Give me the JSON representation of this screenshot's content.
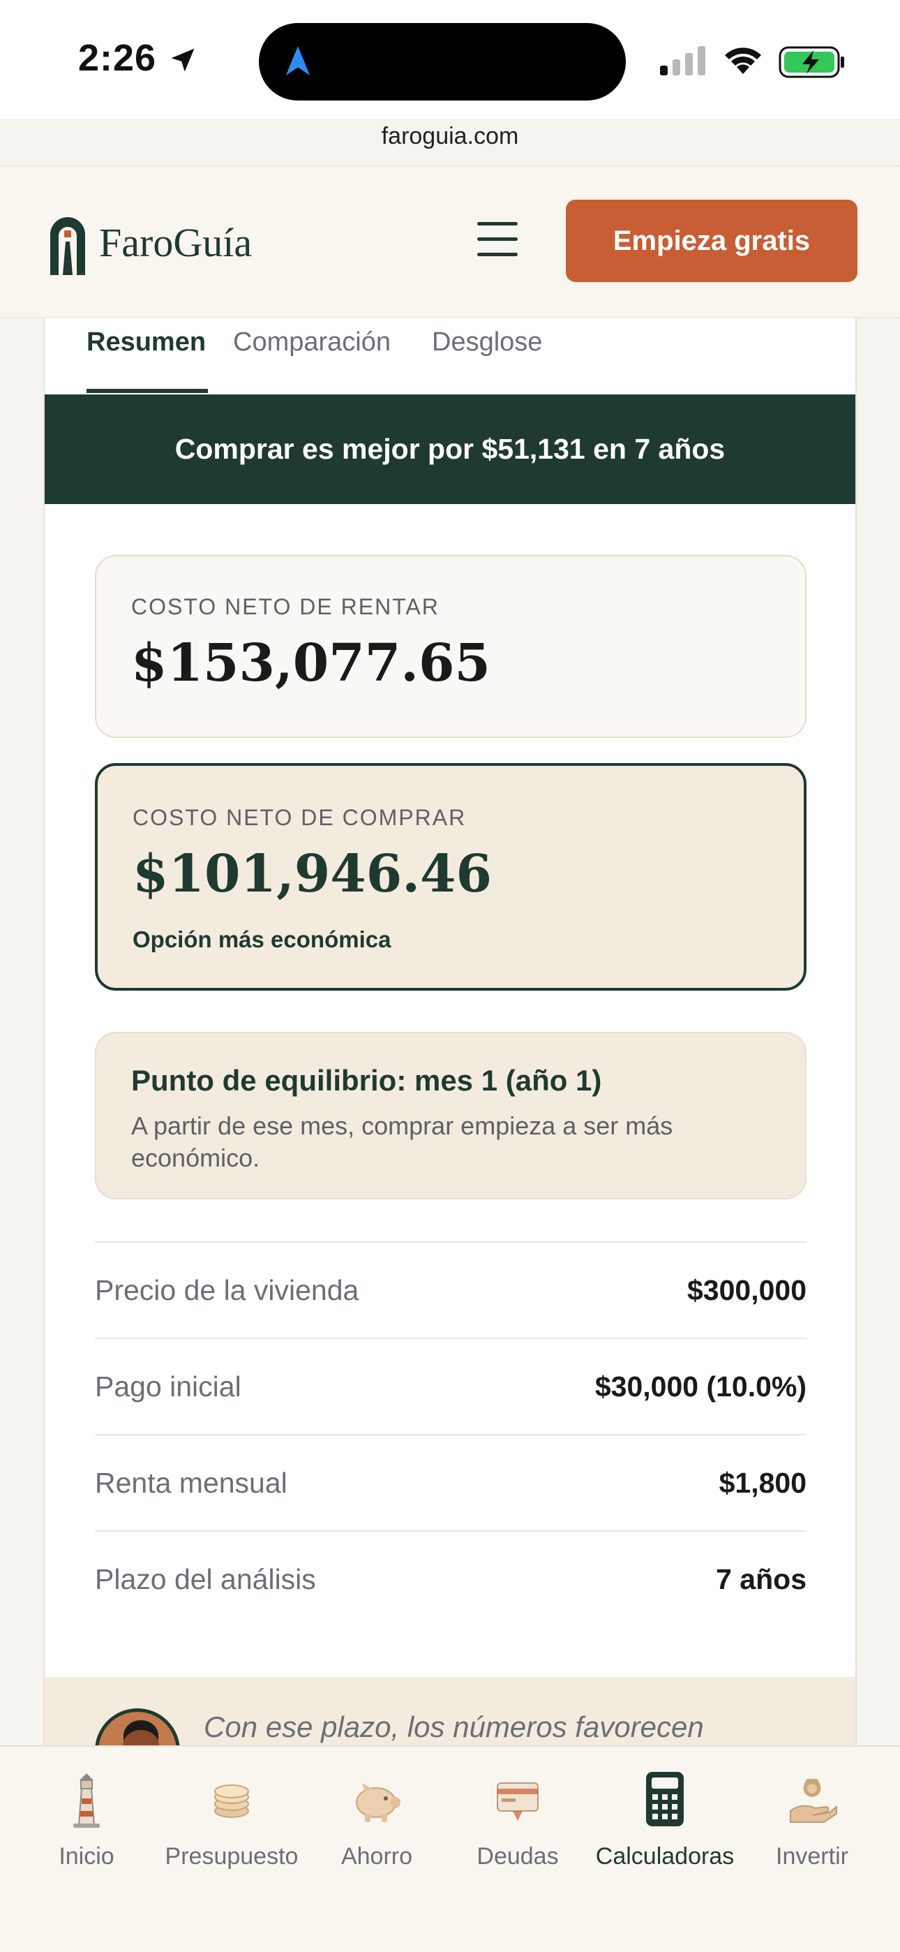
{
  "status_bar": {
    "time": "2:26"
  },
  "browser": {
    "url": "faroguia.com"
  },
  "header": {
    "brand": "FaroGuía",
    "cta_label": "Empieza gratis"
  },
  "tabs": [
    {
      "label": "Resumen",
      "active": true
    },
    {
      "label": "Comparación",
      "active": false
    },
    {
      "label": "Desglose",
      "active": false
    }
  ],
  "banner": {
    "text": "Comprar es mejor por $51,131 en 7 años"
  },
  "rent_card": {
    "label": "COSTO NETO DE RENTAR",
    "value": "$153,077.65"
  },
  "buy_card": {
    "label": "COSTO NETO DE COMPRAR",
    "value": "$101,946.46",
    "note": "Opción más económica"
  },
  "breakeven": {
    "title": "Punto de equilibrio: mes 1 (año 1)",
    "description": "A partir de ese mes, comprar empieza a ser más económico."
  },
  "summary_rows": [
    {
      "label": "Precio de la vivienda",
      "value": "$300,000"
    },
    {
      "label": "Pago inicial",
      "value": "$30,000 (10.0%)"
    },
    {
      "label": "Renta mensual",
      "value": "$1,800"
    },
    {
      "label": "Plazo del análisis",
      "value": "7 años"
    }
  ],
  "advisor": {
    "text": "Con ese plazo, los números favorecen"
  },
  "bottom_nav": [
    {
      "label": "Inicio",
      "icon": "lighthouse-icon",
      "active": false
    },
    {
      "label": "Presupuesto",
      "icon": "coins-icon",
      "active": false
    },
    {
      "label": "Ahorro",
      "icon": "piggy-bank-icon",
      "active": false
    },
    {
      "label": "Deudas",
      "icon": "credit-card-icon",
      "active": false
    },
    {
      "label": "Calculadoras",
      "icon": "calculator-icon",
      "active": true
    },
    {
      "label": "Invertir",
      "icon": "money-hand-icon",
      "active": false
    }
  ],
  "colors": {
    "primary": "#1f3a30",
    "accent": "#c85e33",
    "cream": "#f4ebdf",
    "background": "#f8f6ef"
  }
}
